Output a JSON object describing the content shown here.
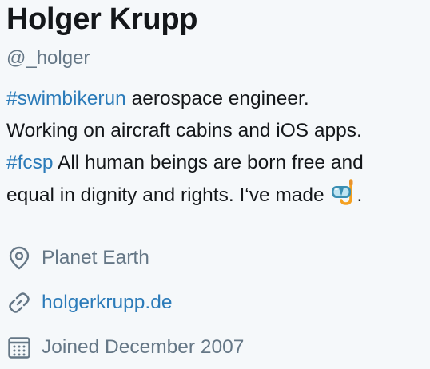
{
  "profile": {
    "name": "Holger Krupp",
    "handle": "@_holger",
    "bio": {
      "line1_tag": "#swimbikerun",
      "line1_rest": " aerospace engineer.",
      "line2": "Working on aircraft cabins and iOS apps.",
      "line3_tag": "#fcsp",
      "line3_rest": " All human beings are born free and",
      "line4": "equal in dignity and rights. I‘ve made ",
      "line4_end": ".",
      "emoji_icon": "diving-mask-icon"
    },
    "location": "Planet Earth",
    "website": "holgerkrupp.de",
    "joined": "Joined December 2007"
  },
  "colors": {
    "text": "#14171a",
    "secondary": "#657786",
    "link": "#2b7bb9",
    "background": "#f5f8fa"
  },
  "icons": {
    "location": "map-pin-icon",
    "website": "link-icon",
    "joined": "calendar-icon"
  }
}
